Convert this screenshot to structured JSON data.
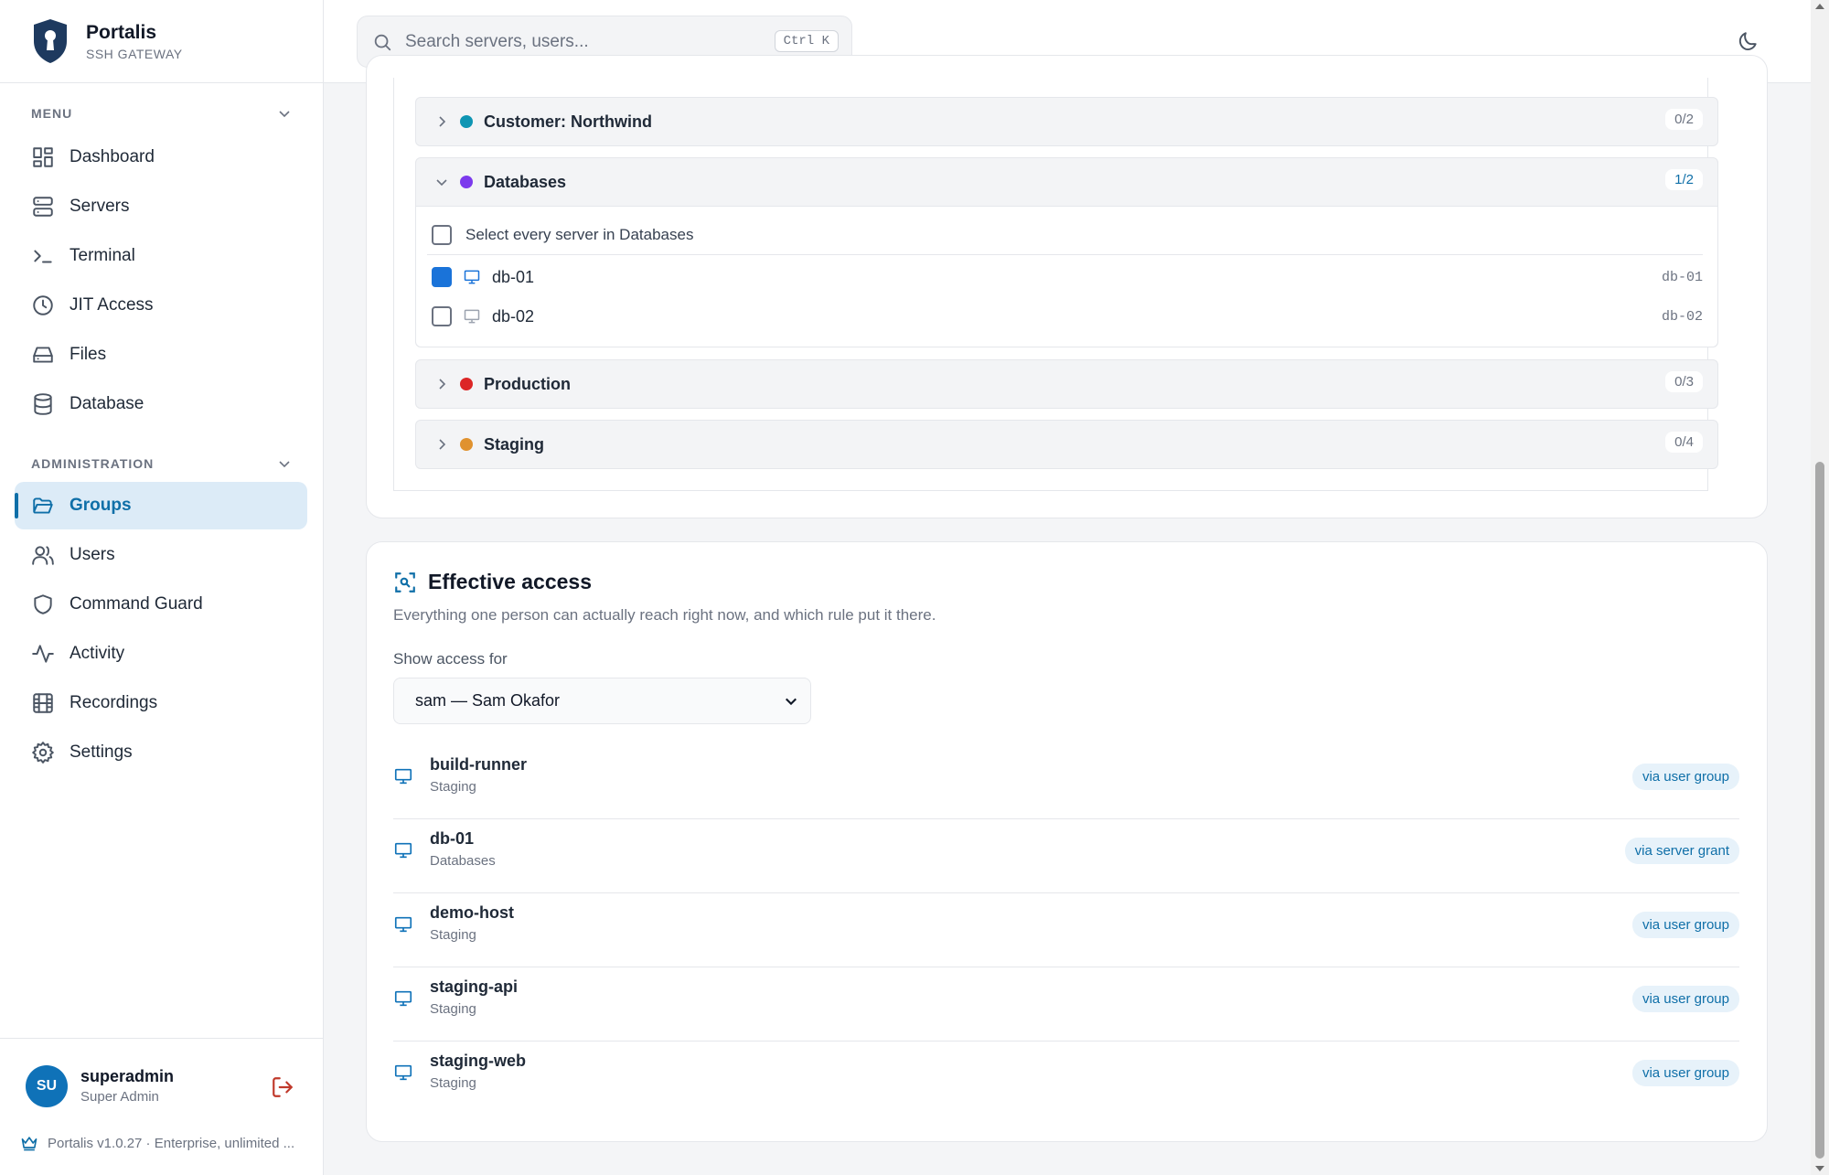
{
  "brand": {
    "name": "Portalis",
    "subtitle": "SSH GATEWAY"
  },
  "sidebar": {
    "menu_heading": "MENU",
    "menu_items": [
      {
        "label": "Dashboard",
        "icon": "dashboard-icon"
      },
      {
        "label": "Servers",
        "icon": "servers-icon"
      },
      {
        "label": "Terminal",
        "icon": "terminal-icon"
      },
      {
        "label": "JIT Access",
        "icon": "clock-icon"
      },
      {
        "label": "Files",
        "icon": "drive-icon"
      },
      {
        "label": "Database",
        "icon": "database-icon"
      }
    ],
    "admin_heading": "ADMINISTRATION",
    "admin_items": [
      {
        "label": "Groups",
        "icon": "folder-icon",
        "active": true
      },
      {
        "label": "Users",
        "icon": "users-icon"
      },
      {
        "label": "Command Guard",
        "icon": "shield-icon"
      },
      {
        "label": "Activity",
        "icon": "activity-icon"
      },
      {
        "label": "Recordings",
        "icon": "film-icon"
      },
      {
        "label": "Settings",
        "icon": "gear-icon"
      }
    ],
    "user": {
      "initials": "SU",
      "name": "superadmin",
      "role": "Super Admin"
    },
    "version": "Portalis v1.0.27 · Enterprise, unlimited ..."
  },
  "header": {
    "search_placeholder": "Search servers, users...",
    "shortcut": "Ctrl K"
  },
  "server_groups": [
    {
      "name": "Customer: Northwind",
      "count": "0/2",
      "color": "#0e95b3",
      "expanded": false
    },
    {
      "name": "Databases",
      "count": "1/2",
      "color": "#7c3aed",
      "expanded": true,
      "select_all_label": "Select every server in Databases",
      "servers": [
        {
          "name": "db-01",
          "host": "db-01",
          "checked": true
        },
        {
          "name": "db-02",
          "host": "db-02",
          "checked": false
        }
      ]
    },
    {
      "name": "Production",
      "count": "0/3",
      "color": "#dc2626",
      "expanded": false
    },
    {
      "name": "Staging",
      "count": "0/4",
      "color": "#e0922f",
      "expanded": false
    }
  ],
  "effective_access": {
    "title": "Effective access",
    "description": "Everything one person can actually reach right now, and which rule put it there.",
    "select_label": "Show access for",
    "selected_user": "sam — Sam Okafor",
    "rows": [
      {
        "server": "build-runner",
        "group": "Staging",
        "via": "via user group"
      },
      {
        "server": "db-01",
        "group": "Databases",
        "via": "via server grant"
      },
      {
        "server": "demo-host",
        "group": "Staging",
        "via": "via user group"
      },
      {
        "server": "staging-api",
        "group": "Staging",
        "via": "via user group"
      },
      {
        "server": "staging-web",
        "group": "Staging",
        "via": "via user group"
      }
    ]
  },
  "colors": {
    "accent": "#0f6fa8",
    "active_bg": "#dcebf7",
    "checkbox": "#1a73d9",
    "logout": "#c0392b"
  }
}
